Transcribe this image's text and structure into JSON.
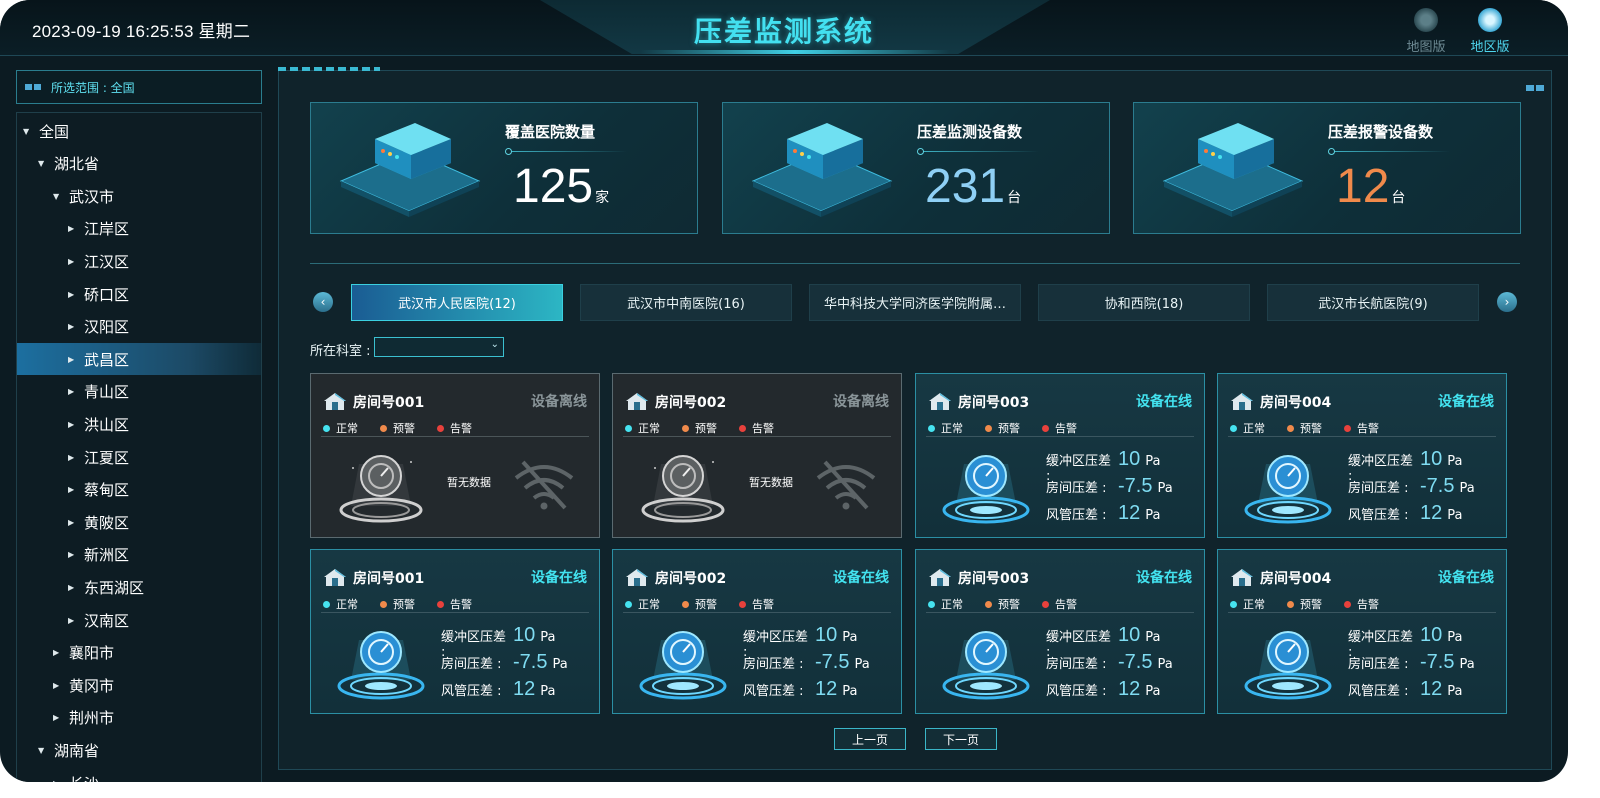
{
  "header": {
    "datetime": "2023-09-19 16:25:53 星期二",
    "title": "压差监测系统",
    "views": [
      {
        "label": "地图版",
        "active": false
      },
      {
        "label": "地区版",
        "active": true
      }
    ]
  },
  "sidebar": {
    "scope_text": "所选范围 : 全国",
    "tree": [
      {
        "label": "全国",
        "level": 0,
        "expanded": true
      },
      {
        "label": "湖北省",
        "level": 1,
        "expanded": true
      },
      {
        "label": "武汉市",
        "level": 2,
        "expanded": true
      },
      {
        "label": "江岸区",
        "level": 3,
        "expanded": false
      },
      {
        "label": "江汉区",
        "level": 3,
        "expanded": false
      },
      {
        "label": "硚口区",
        "level": 3,
        "expanded": false
      },
      {
        "label": "汉阳区",
        "level": 3,
        "expanded": false
      },
      {
        "label": "武昌区",
        "level": 3,
        "expanded": false,
        "selected": true
      },
      {
        "label": "青山区",
        "level": 3,
        "expanded": false
      },
      {
        "label": "洪山区",
        "level": 3,
        "expanded": false
      },
      {
        "label": "江夏区",
        "level": 3,
        "expanded": false
      },
      {
        "label": "蔡甸区",
        "level": 3,
        "expanded": false
      },
      {
        "label": "黄陂区",
        "level": 3,
        "expanded": false
      },
      {
        "label": "新洲区",
        "level": 3,
        "expanded": false
      },
      {
        "label": "东西湖区",
        "level": 3,
        "expanded": false
      },
      {
        "label": "汉南区",
        "level": 3,
        "expanded": false
      },
      {
        "label": "襄阳市",
        "level": 2,
        "expanded": false
      },
      {
        "label": "黄冈市",
        "level": 2,
        "expanded": false
      },
      {
        "label": "荆州市",
        "level": 2,
        "expanded": false
      },
      {
        "label": "湖南省",
        "level": 1,
        "expanded": true
      },
      {
        "label": "长沙",
        "level": 2,
        "expanded": false
      }
    ]
  },
  "stats": [
    {
      "label": "覆盖医院数量",
      "value": "125",
      "unit": "家",
      "color": "#ffffff"
    },
    {
      "label": "压差监测设备数",
      "value": "231",
      "unit": "台",
      "color": "#8fd0f5"
    },
    {
      "label": "压差报警设备数",
      "value": "12",
      "unit": "台",
      "color": "#f08a4b"
    }
  ],
  "hospital_tabs": [
    {
      "label": "武汉市人民医院(12)",
      "active": true
    },
    {
      "label": "武汉市中南医院(16)",
      "active": false
    },
    {
      "label": "华中科技大学同济医学院附属…",
      "active": false
    },
    {
      "label": "协和西院(18)",
      "active": false
    },
    {
      "label": "武汉市长航医院(9)",
      "active": false
    }
  ],
  "department": {
    "label": "所在科室 :",
    "value": ""
  },
  "legend": [
    {
      "label": "正常",
      "color": "#46e3f0"
    },
    {
      "label": "预警",
      "color": "#f08a4b"
    },
    {
      "label": "告警",
      "color": "#e8413c"
    }
  ],
  "reading_labels": {
    "buffer": "缓冲区压差 :",
    "room": "房间压差 :",
    "duct": "风管压差 :"
  },
  "no_data_text": "暂无数据",
  "rooms": [
    {
      "title": "房间号001",
      "status": "设备离线",
      "online": false
    },
    {
      "title": "房间号002",
      "status": "设备离线",
      "online": false
    },
    {
      "title": "房间号003",
      "status": "设备在线",
      "online": true,
      "buffer": "10",
      "room": "-7.5",
      "duct": "12",
      "unit": "Pa"
    },
    {
      "title": "房间号004",
      "status": "设备在线",
      "online": true,
      "buffer": "10",
      "room": "-7.5",
      "duct": "12",
      "unit": "Pa"
    },
    {
      "title": "房间号001",
      "status": "设备在线",
      "online": true,
      "buffer": "10",
      "room": "-7.5",
      "duct": "12",
      "unit": "Pa"
    },
    {
      "title": "房间号002",
      "status": "设备在线",
      "online": true,
      "buffer": "10",
      "room": "-7.5",
      "duct": "12",
      "unit": "Pa"
    },
    {
      "title": "房间号003",
      "status": "设备在线",
      "online": true,
      "buffer": "10",
      "room": "-7.5",
      "duct": "12",
      "unit": "Pa"
    },
    {
      "title": "房间号004",
      "status": "设备在线",
      "online": true,
      "buffer": "10",
      "room": "-7.5",
      "duct": "12",
      "unit": "Pa"
    }
  ],
  "pagination": {
    "prev": "上一页",
    "next": "下一页"
  },
  "icons": {
    "map_view": "map-globe-icon",
    "region_view": "region-globe-icon",
    "prev_arrow": "chevron-left-icon",
    "next_arrow": "chevron-right-icon",
    "stat": "server-box-icon",
    "room": "house-icon",
    "gauge": "pressure-gauge-icon",
    "wifi_off": "wifi-off-icon"
  }
}
